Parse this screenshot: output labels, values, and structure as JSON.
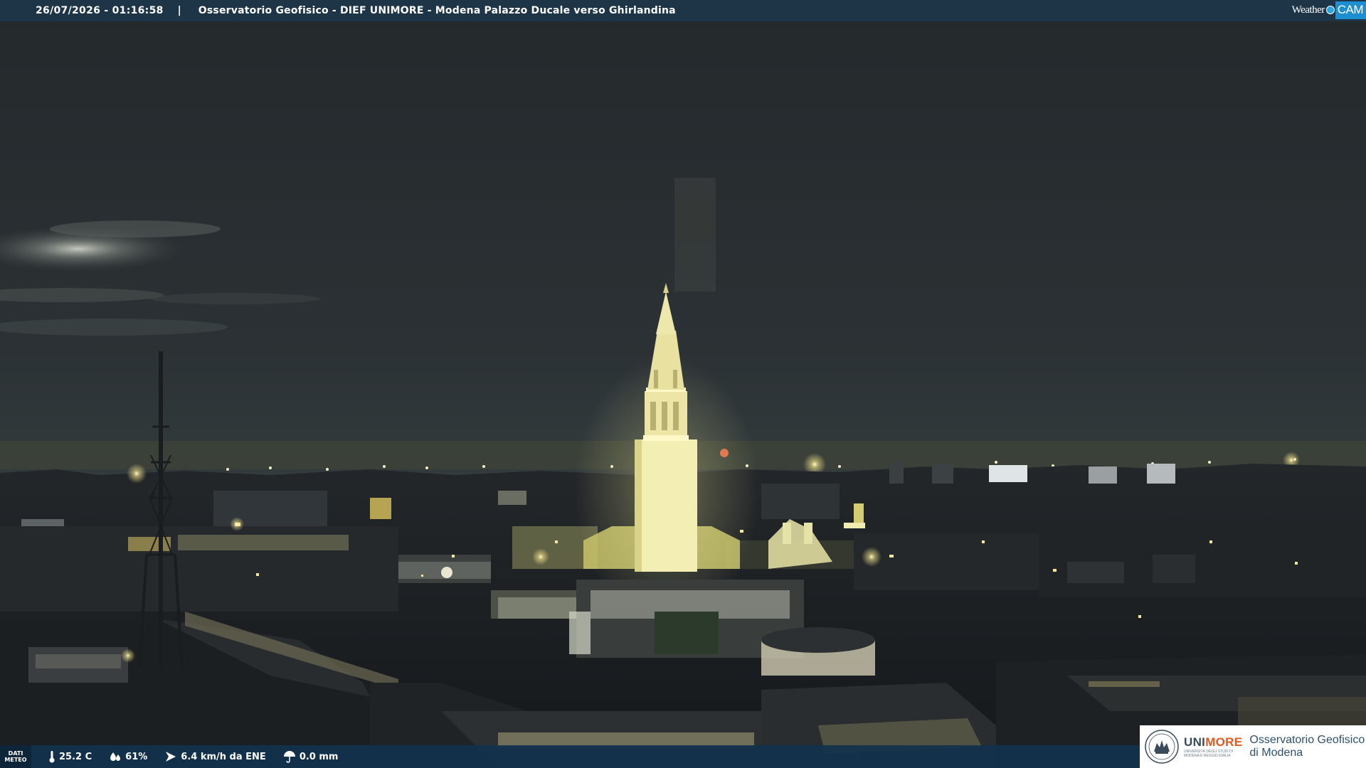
{
  "header": {
    "datetime": "26/07/2026 - 01:16:58",
    "separator": "|",
    "title": "Osservatorio Geofisico - DIEF UNIMORE - Modena Palazzo Ducale verso Ghirlandina"
  },
  "brand": {
    "weather_text": "Weather",
    "cam_text": "CAM"
  },
  "weather_bar": {
    "badge_line1": "DATI",
    "badge_line2": "METEO",
    "temperature": "25.2 C",
    "humidity": "61%",
    "wind": "6.4 km/h da ENE",
    "rain": "0.0 mm"
  },
  "institution": {
    "name_part1": "UNI",
    "name_part2": "MORE",
    "subline1": "UNIVERSITÀ DEGLI STUDI DI",
    "subline2": "MODENA E REGGIO EMILIA",
    "observatory_line1": "Osservatorio Geofisico",
    "observatory_line2": "di Modena"
  },
  "colors": {
    "top_bar": "#1e3548",
    "bottom_bar": "#12324e",
    "accent_blue": "#1d8fd0",
    "unimore_orange": "#e05a1e"
  }
}
